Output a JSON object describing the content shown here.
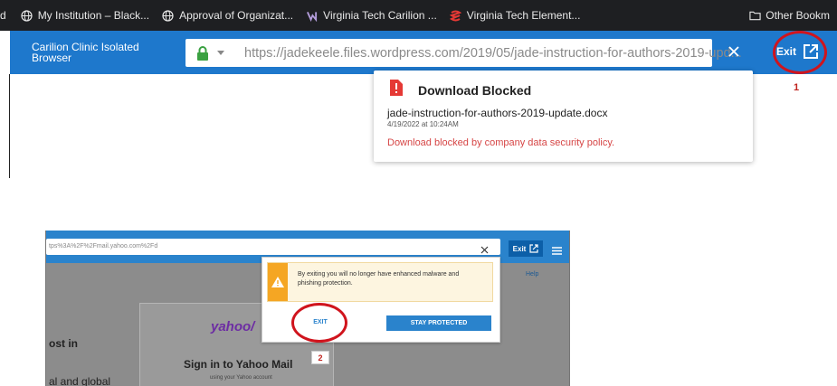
{
  "bookmarks": {
    "cut_label": "d",
    "items": [
      {
        "label": "My Institution – Black...",
        "icon": "globe-icon"
      },
      {
        "label": "Approval of Organizat...",
        "icon": "globe-icon"
      },
      {
        "label": "Virginia Tech Carilion ...",
        "icon": "vt-logo-icon"
      },
      {
        "label": "Virginia Tech Element...",
        "icon": "element-logo-icon"
      }
    ],
    "other": "Other Bookm"
  },
  "isolated_browser": {
    "title_line1": "Carilion Clinic Isolated",
    "title_line2": "Browser",
    "url": "https://jadekeele.files.wordpress.com/2019/05/jade-instruction-for-authors-2019-upd...",
    "exit_label": "Exit"
  },
  "download_panel": {
    "title": "Download Blocked",
    "filename": "jade-instruction-for-authors-2019-update.docx",
    "date": "4/19/2022 at 10:24AM",
    "message": "Download blocked by company data security policy."
  },
  "annotations": {
    "step1": "1",
    "step2": "2"
  },
  "exit_dialog_screenshot": {
    "url_fragment": "tps%3A%2F%2Fmail.yahoo.com%2Fd",
    "exit_label": "Exit",
    "help_label": "Help",
    "warning_text": "By exiting you will no longer have enhanced malware and phishing protection.",
    "exit_button": "EXIT",
    "stay_button": "STAY PROTECTED",
    "yahoo_logo": "yahoo/",
    "signin_title": "Sign in to Yahoo Mail",
    "signin_sub": "using your Yahoo account",
    "left_text1": "ost in",
    "left_text2": "al and global"
  },
  "colors": {
    "accent_blue": "#1e78cc",
    "error_red": "#d64545",
    "annotation_red": "#d0141d",
    "warning_orange": "#f5a623"
  }
}
